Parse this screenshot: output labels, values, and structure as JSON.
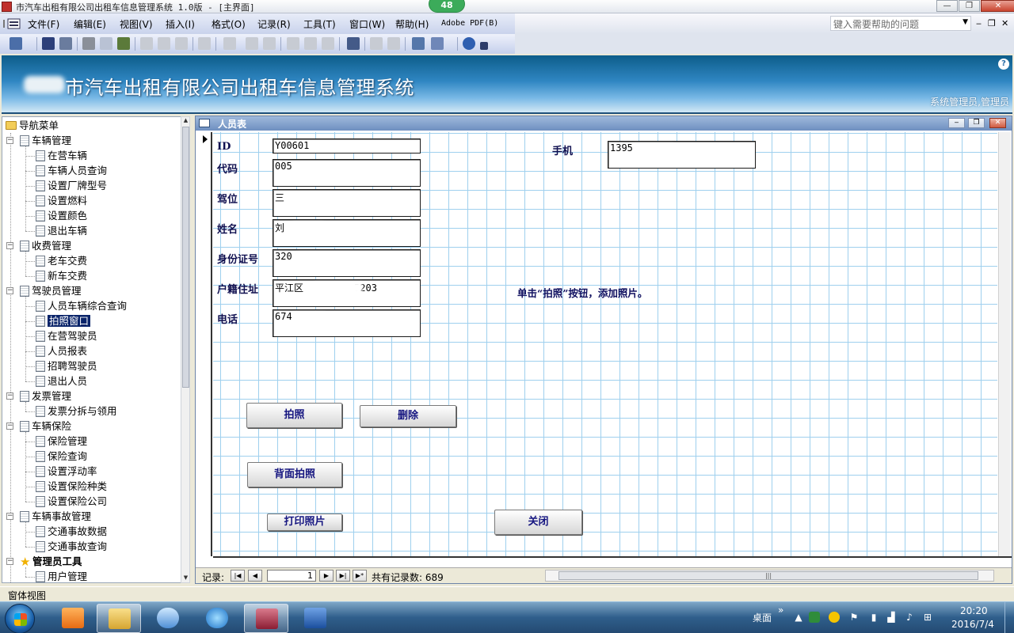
{
  "window": {
    "title": "市汽车出租有限公司出租车信息管理系统 1.0版 - [主界面]",
    "badge": "48",
    "minimize": "—",
    "restore": "❐",
    "close": "✕"
  },
  "menu": {
    "items": [
      "文件(F)",
      "编辑(E)",
      "视图(V)",
      "插入(I)",
      "格式(O)",
      "记录(R)",
      "工具(T)",
      "窗口(W)",
      "帮助(H)",
      "Adobe PDF(B)"
    ],
    "help_placeholder": "键入需要帮助的问题",
    "mdi_minimize": "‒",
    "mdi_restore": "❐",
    "mdi_close": "✕"
  },
  "banner": {
    "title": "市汽车出租有限公司出租车信息管理系统",
    "user": "系统管理员,管理员",
    "help": "?"
  },
  "nav_tree": {
    "root": "导航菜单",
    "groups": [
      {
        "label": "车辆管理",
        "items": [
          "在营车辆",
          "车辆人员查询",
          "设置厂牌型号",
          "设置燃料",
          "设置颜色",
          "退出车辆"
        ]
      },
      {
        "label": "收费管理",
        "items": [
          "老车交费",
          "新车交费"
        ]
      },
      {
        "label": "驾驶员管理",
        "items": [
          "人员车辆综合查询",
          "拍照窗口",
          "在营驾驶员",
          "人员报表",
          "招聘驾驶员",
          "退出人员"
        ]
      },
      {
        "label": "发票管理",
        "items": [
          "发票分拆与领用"
        ]
      },
      {
        "label": "车辆保险",
        "items": [
          "保险管理",
          "保险查询",
          "设置浮动率",
          "设置保险种类",
          "设置保险公司"
        ]
      },
      {
        "label": "车辆事故管理",
        "items": [
          "交通事故数据",
          "交通事故查询"
        ]
      },
      {
        "label": "管理员工具",
        "items": [
          "用户管理"
        ]
      }
    ],
    "selected": "拍照窗口"
  },
  "form": {
    "title": "人员表",
    "fields": {
      "id": {
        "label": "ID",
        "value": "Y00601"
      },
      "code": {
        "label": "代码",
        "value": "005"
      },
      "seat": {
        "label": "驾位",
        "value": "三"
      },
      "name": {
        "label": "姓名",
        "value": "刘"
      },
      "idcard": {
        "label": "身份证号",
        "value": "320"
      },
      "address": {
        "label": "户籍住址",
        "value": "平江区",
        "value_tail": "5203"
      },
      "phone": {
        "label": "电话",
        "value": "674"
      },
      "mobile": {
        "label": "手机",
        "value": "1395"
      }
    },
    "hint": "单击“拍照”按钮，添加照片。",
    "buttons": {
      "photo": "拍照",
      "delete": "删除",
      "back_photo": "背面拍照",
      "print": "打印照片",
      "close": "关闭"
    }
  },
  "record_nav": {
    "label": "记录:",
    "current": "1",
    "total": "共有记录数: 689",
    "first": "|◀",
    "prev": "◀",
    "next": "▶",
    "last": "▶|",
    "new": "▶*"
  },
  "status_bar": {
    "text": "窗体视图"
  },
  "taskbar": {
    "desktop": "桌面",
    "chevron": "»",
    "time": "20:20",
    "date": "2016/7/4"
  }
}
